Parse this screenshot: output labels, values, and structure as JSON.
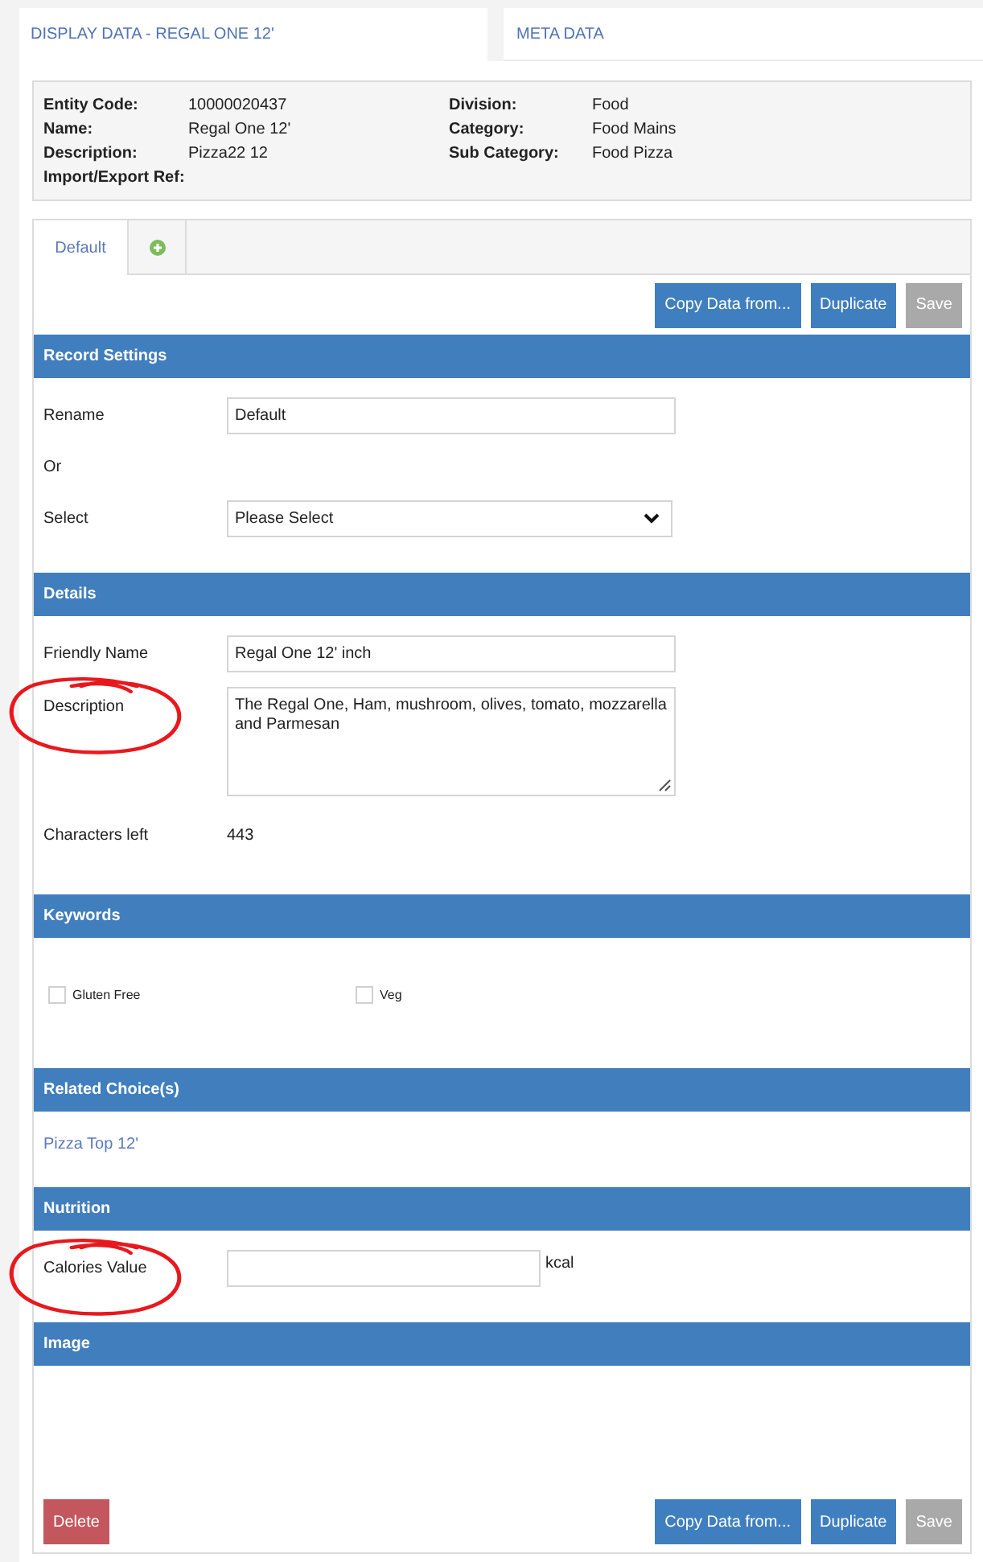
{
  "page_tabs": [
    {
      "label": "DISPLAY DATA - REGAL ONE 12'",
      "selected": true
    },
    {
      "label": "META DATA",
      "selected": false
    }
  ],
  "summary": {
    "columns": [
      [
        {
          "label": "Entity Code:",
          "value": "10000020437"
        },
        {
          "label": "Name:",
          "value": "Regal One 12'"
        },
        {
          "label": "Description:",
          "value": "Pizza22 12"
        },
        {
          "label": "Import/Export Ref:"
        }
      ],
      [
        {
          "label": "Division:",
          "value": "Food"
        },
        {
          "label": "Category:",
          "value": "Food Mains"
        },
        {
          "label": "Sub Category:",
          "value": "Food Pizza"
        }
      ]
    ]
  },
  "record_tabs": [
    {
      "kind": "label",
      "label": "Default",
      "selected": true
    },
    {
      "kind": "add",
      "selected": false
    }
  ],
  "toolbar": [
    {
      "kind": "primary",
      "label": "Copy Data from...",
      "disabled": false
    },
    {
      "kind": "primary",
      "label": "Duplicate",
      "disabled": false
    },
    {
      "kind": "primary",
      "label": "Save",
      "disabled": true
    }
  ],
  "sections": [
    {
      "title": "Record Settings",
      "rows": [
        {
          "kind": "input",
          "label": "Rename",
          "value": "Default",
          "circled": false
        },
        {
          "kind": "text",
          "label": "Or",
          "circled": false
        },
        {
          "kind": "select",
          "label": "Select",
          "value": "Please Select",
          "circled": false
        }
      ]
    },
    {
      "title": "Details",
      "rows": [
        {
          "kind": "input",
          "label": "Friendly Name",
          "value": "Regal One 12' inch",
          "circled": false
        },
        {
          "kind": "textarea",
          "label": "Description",
          "value": "The Regal One, Ham, mushroom, olives, tomato, mozzarella and Parmesan",
          "circled": true
        },
        {
          "kind": "static",
          "label": "Characters left",
          "value": "443",
          "circled": false
        }
      ]
    },
    {
      "title": "Keywords",
      "rows": [
        {
          "kind": "checkboxes",
          "items": [
            {
              "label": "Gluten Free",
              "checked": false
            },
            {
              "label": "Veg",
              "checked": false
            }
          ]
        }
      ]
    },
    {
      "title": "Related Choice(s)",
      "rows": [
        {
          "kind": "link",
          "label": "Pizza Top 12'"
        }
      ]
    },
    {
      "title": "Nutrition",
      "rows": [
        {
          "kind": "input",
          "label": "Calories Value",
          "unit": "kcal",
          "circled": true
        }
      ]
    },
    {
      "title": "Image"
    }
  ],
  "footer": [
    {
      "kind": "danger",
      "label": "Delete",
      "disabled": false
    },
    {
      "kind": "primary",
      "label": "Copy Data from...",
      "disabled": false
    },
    {
      "kind": "primary",
      "label": "Duplicate",
      "disabled": false
    },
    {
      "kind": "primary",
      "label": "Save",
      "disabled": true
    }
  ]
}
